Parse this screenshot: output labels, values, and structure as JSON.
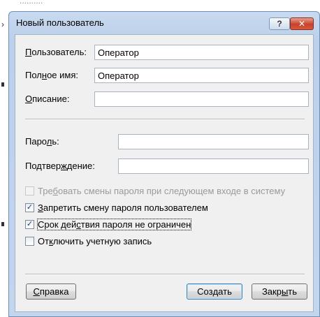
{
  "background": {
    "top_text": "..........",
    "left_chevron": "›"
  },
  "dialog": {
    "title": "Новый пользователь",
    "help_label": "?",
    "close_label": "✕"
  },
  "fields": {
    "username_label_pre": "",
    "username_label_key": "П",
    "username_label_post": "ользователь:",
    "username_value": "Оператор",
    "fullname_label_pre": "Пол",
    "fullname_label_key": "н",
    "fullname_label_post": "ое имя:",
    "fullname_value": "Оператор",
    "description_label_pre": "",
    "description_label_key": "О",
    "description_label_post": "писание:",
    "description_value": "",
    "password_label_pre": "Паро",
    "password_label_key": "л",
    "password_label_post": "ь:",
    "password_value": "",
    "confirm_label_pre": "Подтвер",
    "confirm_label_key": "ж",
    "confirm_label_post": "дение:",
    "confirm_value": ""
  },
  "checkboxes": {
    "require_change_pre": "Тре",
    "require_change_key": "б",
    "require_change_post": "овать смены пароля при следующем входе в систему",
    "require_change_checked": false,
    "require_change_enabled": false,
    "forbid_change_pre": "",
    "forbid_change_key": "З",
    "forbid_change_post": "апретить смену пароля пользователем",
    "forbid_change_checked": true,
    "never_expires_pre": "Срок дей",
    "never_expires_key": "с",
    "never_expires_post": "твия пароля не ограничен",
    "never_expires_checked": true,
    "disable_account_pre": "От",
    "disable_account_key": "к",
    "disable_account_post": "лючить учетную запись",
    "disable_account_checked": false,
    "check_glyph": "✓"
  },
  "buttons": {
    "help_pre": "",
    "help_key": "С",
    "help_post": "правка",
    "create_pre": "Соз",
    "create_key": "д",
    "create_post": "ать",
    "close_pre": "Закр",
    "close_key": "ы",
    "close_post": "ть"
  },
  "colors": {
    "title_bar": "#bcd0ea",
    "close_button": "#c8412a",
    "client_background": "#f0f0f0",
    "check_mark": "#1c3e74"
  }
}
